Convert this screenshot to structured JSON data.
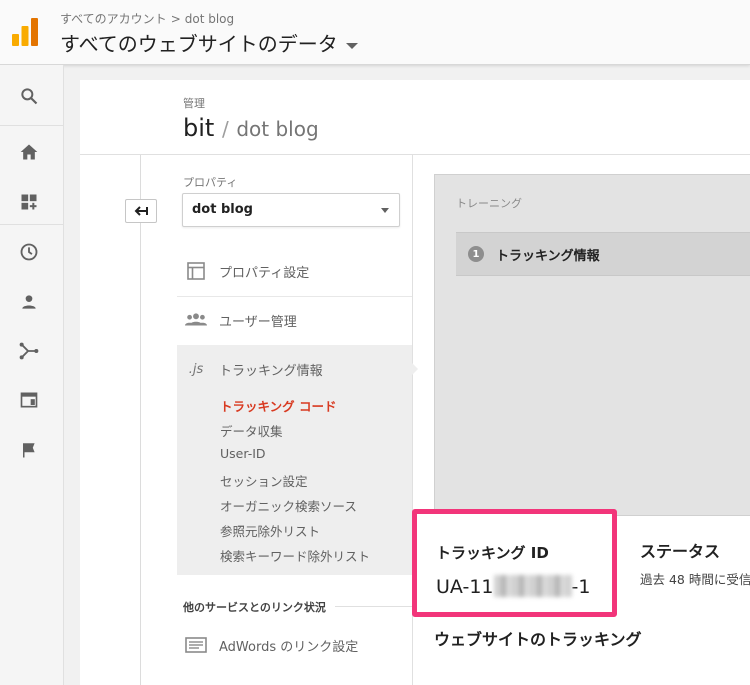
{
  "header": {
    "breadcrumb_account": "すべてのアカウント",
    "breadcrumb_sep": ">",
    "breadcrumb_property": "dot blog",
    "view_title": "すべてのウェブサイトのデータ"
  },
  "leftnav": {
    "icons": [
      "search-icon",
      "home-icon",
      "dashboard-add-icon",
      "clock-icon",
      "person-icon",
      "fork-icon",
      "browser-window-icon",
      "flag-icon"
    ]
  },
  "admin": {
    "label": "管理",
    "account": "bit",
    "slash": "/",
    "property": "dot blog"
  },
  "property_column": {
    "label": "プロパティ",
    "selected": "dot blog",
    "items": [
      {
        "label": "プロパティ設定",
        "icon": "layout-icon"
      },
      {
        "label": "ユーザー管理",
        "icon": "people-icon"
      },
      {
        "label": "トラッキング情報",
        "icon": "js-icon",
        "icon_text": ".js"
      }
    ],
    "sub_items": [
      {
        "label": "トラッキング コード",
        "active": true
      },
      {
        "label": "データ収集"
      },
      {
        "label": "User-ID"
      },
      {
        "label": "セッション設定"
      },
      {
        "label": "オーガニック検索ソース"
      },
      {
        "label": "参照元除外リスト"
      },
      {
        "label": "検索キーワード除外リスト"
      }
    ],
    "services_label": "他のサービスとのリンク状況",
    "adwords_label": "AdWords のリンク設定"
  },
  "content": {
    "training_label": "トレーニング",
    "training_step_number": "1",
    "training_step_title": "トラッキング情報",
    "tracking_id_heading": "トラッキング ID",
    "tracking_id_prefix": "UA-11",
    "tracking_id_suffix": "-1",
    "status_heading": "ステータス",
    "status_text": "過去 48 時間に受信",
    "website_tracking_heading": "ウェブサイトのトラッキング"
  },
  "colors": {
    "active_item": "#d83a21",
    "highlight_border": "#f2357a",
    "logo_orange": "#f9ab00",
    "logo_dark_orange": "#e37400"
  }
}
